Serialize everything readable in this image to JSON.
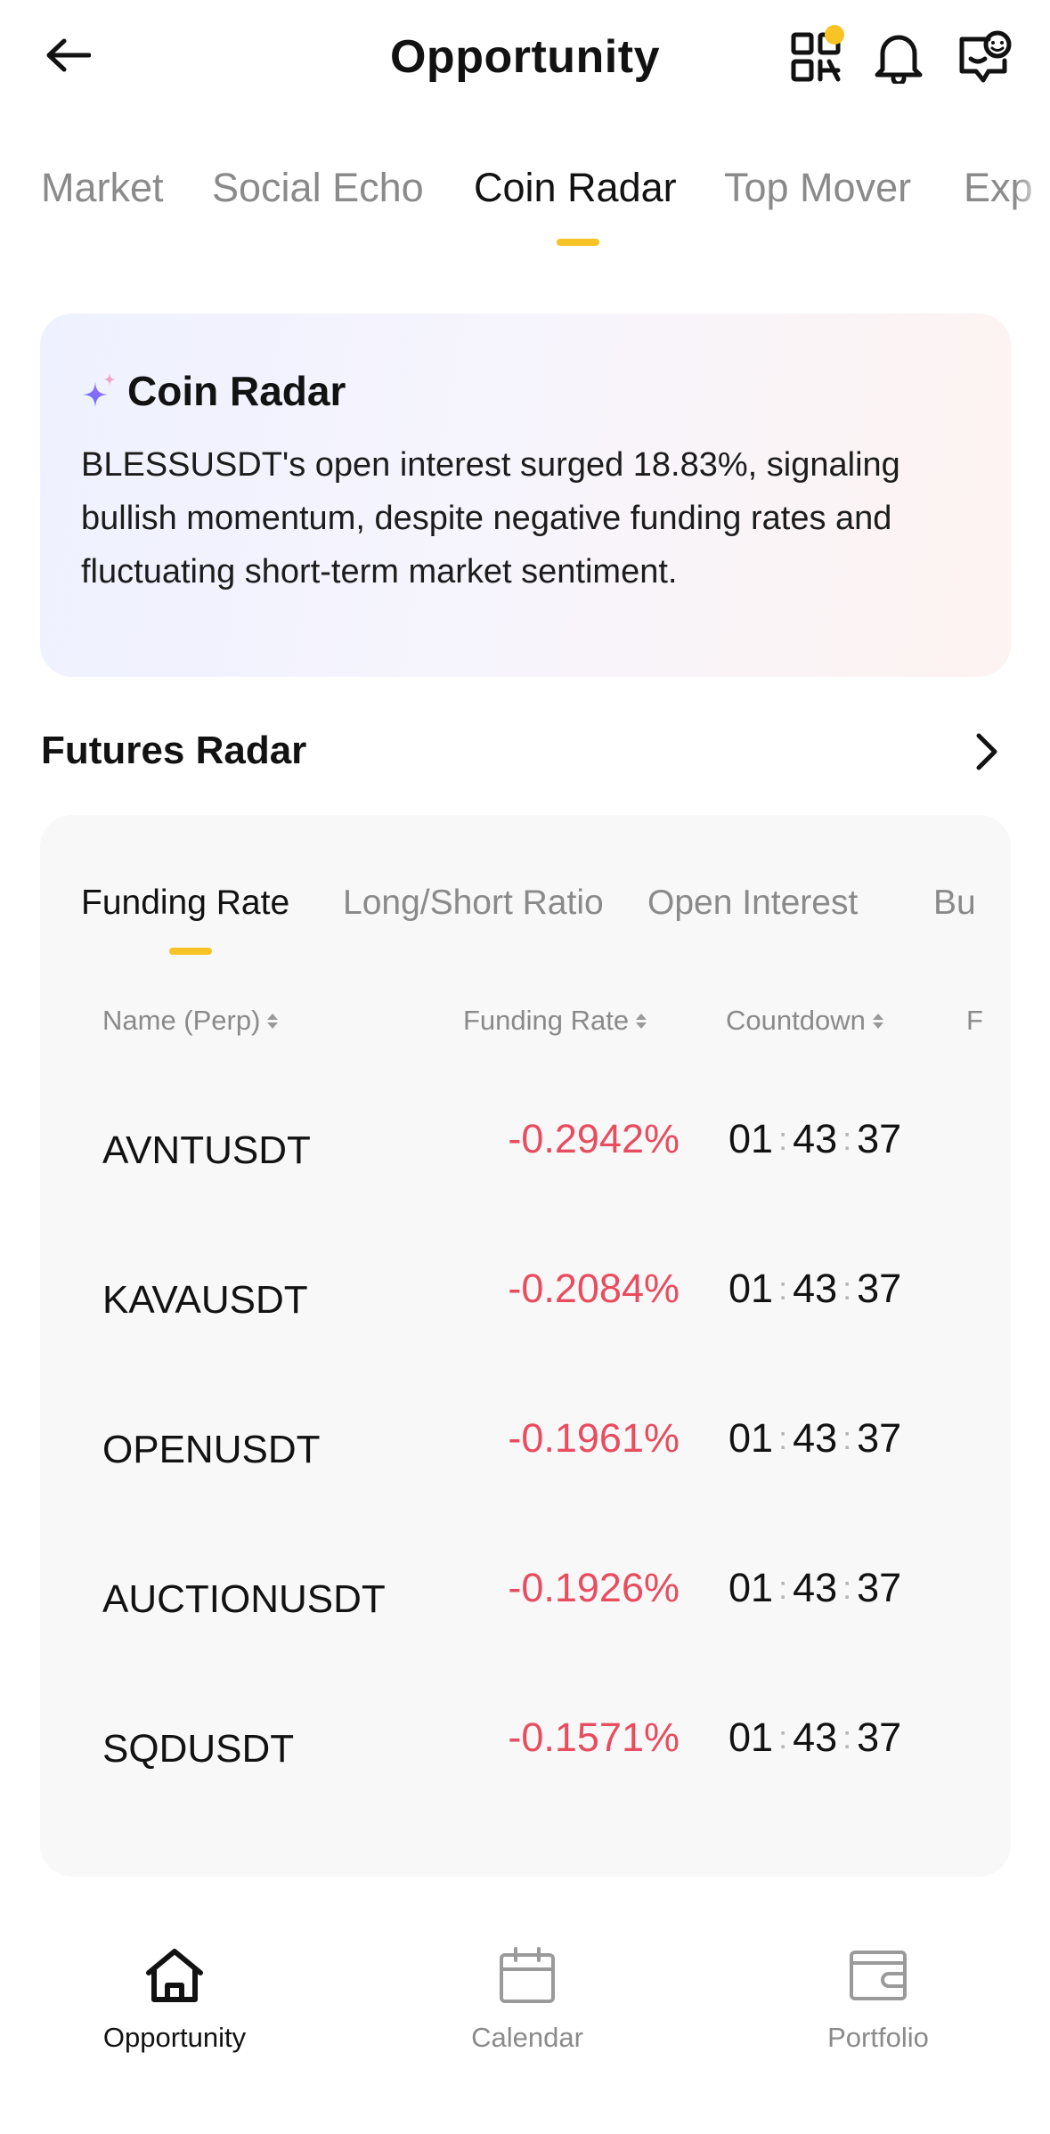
{
  "header": {
    "title": "Opportunity",
    "back_icon": "arrow-left-icon",
    "icons": [
      "qr-scan-icon",
      "bell-icon",
      "support-chat-icon"
    ],
    "notification_dot_color": "#f7c325"
  },
  "top_tabs": [
    {
      "label": "Market",
      "active": false
    },
    {
      "label": "Social Echo",
      "active": false
    },
    {
      "label": "Coin Radar",
      "active": true
    },
    {
      "label": "Top Mover",
      "active": false
    },
    {
      "label": "Exp",
      "active": false
    }
  ],
  "coin_radar": {
    "icon": "sparkle-icon",
    "title": "Coin Radar",
    "summary": "BLESSUSDT's open interest surged 18.83%, signaling bullish momentum, despite negative funding rates and fluctuating short-term market sentiment."
  },
  "futures_radar": {
    "title": "Futures Radar",
    "sub_tabs": [
      {
        "label": "Funding Rate",
        "active": true
      },
      {
        "label": "Long/Short Ratio",
        "active": false
      },
      {
        "label": "Open Interest",
        "active": false
      },
      {
        "label": "Bu",
        "active": false
      }
    ],
    "columns": {
      "name": "Name (Perp)",
      "rate": "Funding Rate",
      "countdown": "Countdown",
      "extra": "F"
    },
    "rows": [
      {
        "name": "AVNTUSDT",
        "rate": "-0.2942%",
        "hh": "01",
        "mm": "43",
        "ss": "37"
      },
      {
        "name": "KAVAUSDT",
        "rate": "-0.2084%",
        "hh": "01",
        "mm": "43",
        "ss": "37"
      },
      {
        "name": "OPENUSDT",
        "rate": "-0.1961%",
        "hh": "01",
        "mm": "43",
        "ss": "37"
      },
      {
        "name": "AUCTIONUSDT",
        "rate": "-0.1926%",
        "hh": "01",
        "mm": "43",
        "ss": "37"
      },
      {
        "name": "SQDUSDT",
        "rate": "-0.1571%",
        "hh": "01",
        "mm": "43",
        "ss": "37"
      }
    ],
    "negative_color": "#e84d5f",
    "accent_color": "#f7c325"
  },
  "bottom_nav": [
    {
      "label": "Opportunity",
      "icon": "home-icon",
      "active": true
    },
    {
      "label": "Calendar",
      "icon": "calendar-icon",
      "active": false
    },
    {
      "label": "Portfolio",
      "icon": "wallet-icon",
      "active": false
    }
  ]
}
